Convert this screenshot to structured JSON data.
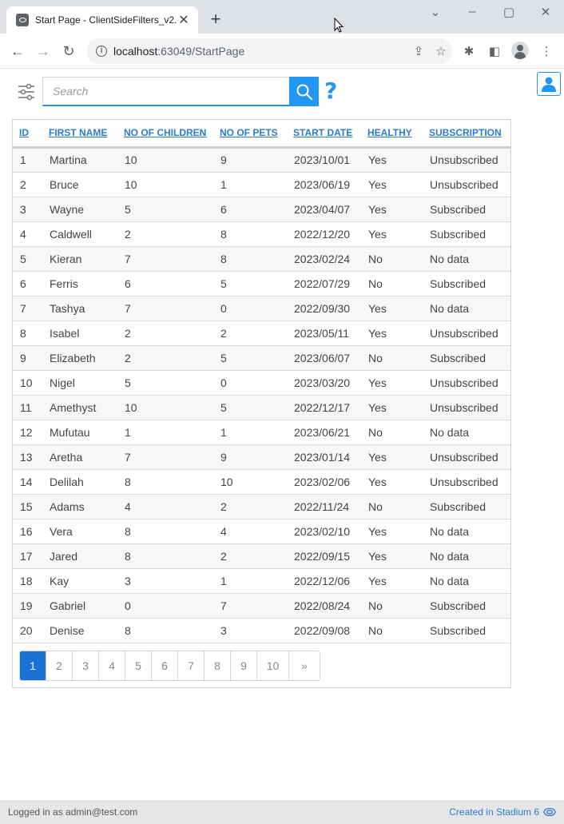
{
  "browser": {
    "tab_title": "Start Page - ClientSideFilters_v2...",
    "tab_close": "✕",
    "new_tab": "+",
    "url_host": "localhost",
    "url_rest": ":63049/StartPage"
  },
  "toolbar": {
    "search_placeholder": "Search",
    "help_label": "?"
  },
  "grid": {
    "columns": [
      "ID",
      "FIRST NAME",
      "NO OF CHILDREN",
      "NO OF PETS",
      "START DATE",
      "HEALTHY",
      "SUBSCRIPTION"
    ],
    "rows": [
      [
        "1",
        "Martina",
        "10",
        "9",
        "2023/10/01",
        "Yes",
        "Unsubscribed"
      ],
      [
        "2",
        "Bruce",
        "10",
        "1",
        "2023/06/19",
        "Yes",
        "Unsubscribed"
      ],
      [
        "3",
        "Wayne",
        "5",
        "6",
        "2023/04/07",
        "Yes",
        "Subscribed"
      ],
      [
        "4",
        "Caldwell",
        "2",
        "8",
        "2022/12/20",
        "Yes",
        "Subscribed"
      ],
      [
        "5",
        "Kieran",
        "7",
        "8",
        "2023/02/24",
        "No",
        "No data"
      ],
      [
        "6",
        "Ferris",
        "6",
        "5",
        "2022/07/29",
        "No",
        "Subscribed"
      ],
      [
        "7",
        "Tashya",
        "7",
        "0",
        "2022/09/30",
        "Yes",
        "No data"
      ],
      [
        "8",
        "Isabel",
        "2",
        "2",
        "2023/05/11",
        "Yes",
        "Unsubscribed"
      ],
      [
        "9",
        "Elizabeth",
        "2",
        "5",
        "2023/06/07",
        "No",
        "Subscribed"
      ],
      [
        "10",
        "Nigel",
        "5",
        "0",
        "2023/03/20",
        "Yes",
        "Unsubscribed"
      ],
      [
        "11",
        "Amethyst",
        "10",
        "5",
        "2022/12/17",
        "Yes",
        "Unsubscribed"
      ],
      [
        "12",
        "Mufutau",
        "1",
        "1",
        "2023/06/21",
        "No",
        "No data"
      ],
      [
        "13",
        "Aretha",
        "7",
        "9",
        "2023/01/14",
        "Yes",
        "Unsubscribed"
      ],
      [
        "14",
        "Delilah",
        "8",
        "10",
        "2023/02/06",
        "Yes",
        "Unsubscribed"
      ],
      [
        "15",
        "Adams",
        "4",
        "2",
        "2022/11/24",
        "No",
        "Subscribed"
      ],
      [
        "16",
        "Vera",
        "8",
        "4",
        "2023/02/10",
        "Yes",
        "No data"
      ],
      [
        "17",
        "Jared",
        "8",
        "2",
        "2022/09/15",
        "Yes",
        "No data"
      ],
      [
        "18",
        "Kay",
        "3",
        "1",
        "2022/12/06",
        "Yes",
        "No data"
      ],
      [
        "19",
        "Gabriel",
        "0",
        "7",
        "2022/08/24",
        "No",
        "Subscribed"
      ],
      [
        "20",
        "Denise",
        "8",
        "3",
        "2022/09/08",
        "No",
        "Subscribed"
      ]
    ]
  },
  "pager": {
    "pages": [
      "1",
      "2",
      "3",
      "4",
      "5",
      "6",
      "7",
      "8",
      "9",
      "10"
    ],
    "active_page": "1",
    "next_label": "»"
  },
  "status": {
    "logged_in": "Logged in as admin@test.com",
    "created_in": "Created in Stadium 6"
  },
  "colors": {
    "accent": "#2196f3",
    "link": "#2b7bd0",
    "pager_active": "#1a73d2"
  }
}
